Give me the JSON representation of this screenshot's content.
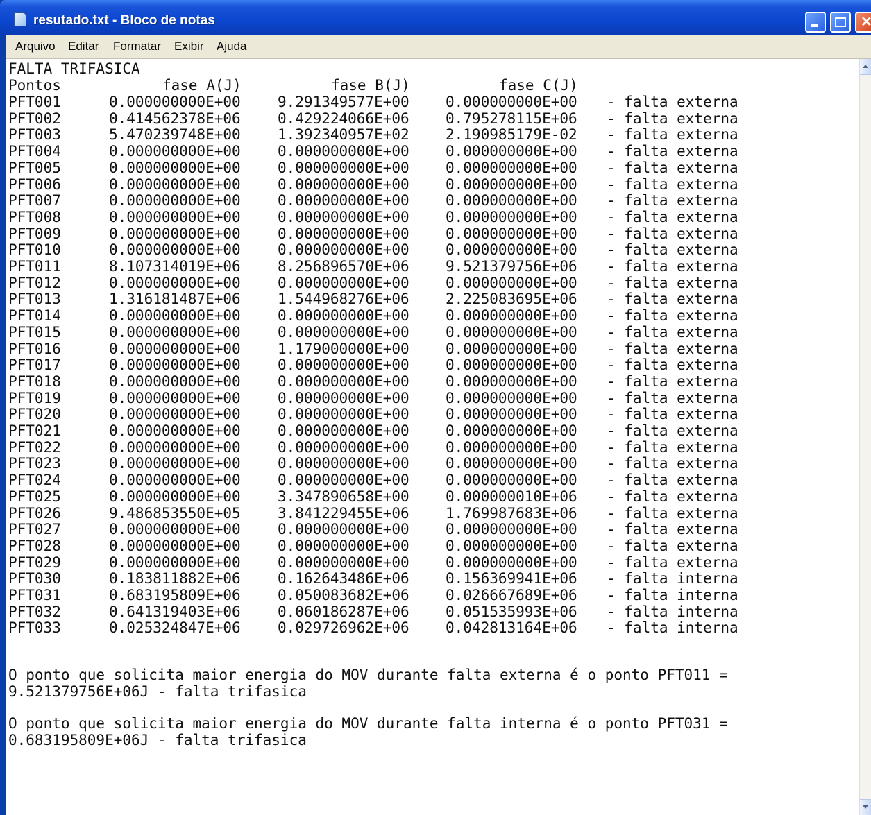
{
  "window": {
    "title": "resutado.txt - Bloco de notas"
  },
  "menu": [
    "Arquivo",
    "Editar",
    "Formatar",
    "Exibir",
    "Ajuda"
  ],
  "doc": {
    "heading": "FALTA TRIFASICA",
    "col_points": "Pontos",
    "col_a": "fase A(J)",
    "col_b": "fase B(J)",
    "col_c": "fase C(J)",
    "rows": [
      [
        "PFT001",
        "0.000000000E+00",
        "9.291349577E+00",
        "0.000000000E+00",
        "- falta externa"
      ],
      [
        "PFT002",
        "0.414562378E+06",
        "0.429224066E+06",
        "0.795278115E+06",
        "- falta externa"
      ],
      [
        "PFT003",
        "5.470239748E+00",
        "1.392340957E+02",
        "2.190985179E-02",
        "- falta externa"
      ],
      [
        "PFT004",
        "0.000000000E+00",
        "0.000000000E+00",
        "0.000000000E+00",
        "- falta externa"
      ],
      [
        "PFT005",
        "0.000000000E+00",
        "0.000000000E+00",
        "0.000000000E+00",
        "- falta externa"
      ],
      [
        "PFT006",
        "0.000000000E+00",
        "0.000000000E+00",
        "0.000000000E+00",
        "- falta externa"
      ],
      [
        "PFT007",
        "0.000000000E+00",
        "0.000000000E+00",
        "0.000000000E+00",
        "- falta externa"
      ],
      [
        "PFT008",
        "0.000000000E+00",
        "0.000000000E+00",
        "0.000000000E+00",
        "- falta externa"
      ],
      [
        "PFT009",
        "0.000000000E+00",
        "0.000000000E+00",
        "0.000000000E+00",
        "- falta externa"
      ],
      [
        "PFT010",
        "0.000000000E+00",
        "0.000000000E+00",
        "0.000000000E+00",
        "- falta externa"
      ],
      [
        "PFT011",
        "8.107314019E+06",
        "8.256896570E+06",
        "9.521379756E+06",
        "- falta externa"
      ],
      [
        "PFT012",
        "0.000000000E+00",
        "0.000000000E+00",
        "0.000000000E+00",
        "- falta externa"
      ],
      [
        "PFT013",
        "1.316181487E+06",
        "1.544968276E+06",
        "2.225083695E+06",
        "- falta externa"
      ],
      [
        "PFT014",
        "0.000000000E+00",
        "0.000000000E+00",
        "0.000000000E+00",
        "- falta externa"
      ],
      [
        "PFT015",
        "0.000000000E+00",
        "0.000000000E+00",
        "0.000000000E+00",
        "- falta externa"
      ],
      [
        "PFT016",
        "0.000000000E+00",
        "1.179000000E+00",
        "0.000000000E+00",
        "- falta externa"
      ],
      [
        "PFT017",
        "0.000000000E+00",
        "0.000000000E+00",
        "0.000000000E+00",
        "- falta externa"
      ],
      [
        "PFT018",
        "0.000000000E+00",
        "0.000000000E+00",
        "0.000000000E+00",
        "- falta externa"
      ],
      [
        "PFT019",
        "0.000000000E+00",
        "0.000000000E+00",
        "0.000000000E+00",
        "- falta externa"
      ],
      [
        "PFT020",
        "0.000000000E+00",
        "0.000000000E+00",
        "0.000000000E+00",
        "- falta externa"
      ],
      [
        "PFT021",
        "0.000000000E+00",
        "0.000000000E+00",
        "0.000000000E+00",
        "- falta externa"
      ],
      [
        "PFT022",
        "0.000000000E+00",
        "0.000000000E+00",
        "0.000000000E+00",
        "- falta externa"
      ],
      [
        "PFT023",
        "0.000000000E+00",
        "0.000000000E+00",
        "0.000000000E+00",
        "- falta externa"
      ],
      [
        "PFT024",
        "0.000000000E+00",
        "0.000000000E+00",
        "0.000000000E+00",
        "- falta externa"
      ],
      [
        "PFT025",
        "0.000000000E+00",
        "3.347890658E+00",
        "0.000000010E+06",
        "- falta externa"
      ],
      [
        "PFT026",
        "9.486853550E+05",
        "3.841229455E+06",
        "1.769987683E+06",
        "- falta externa"
      ],
      [
        "PFT027",
        "0.000000000E+00",
        "0.000000000E+00",
        "0.000000000E+00",
        "- falta externa"
      ],
      [
        "PFT028",
        "0.000000000E+00",
        "0.000000000E+00",
        "0.000000000E+00",
        "- falta externa"
      ],
      [
        "PFT029",
        "0.000000000E+00",
        "0.000000000E+00",
        "0.000000000E+00",
        "- falta externa"
      ],
      [
        "PFT030",
        "0.183811882E+06",
        "0.162643486E+06",
        "0.156369941E+06",
        "- falta interna"
      ],
      [
        "PFT031",
        "0.683195809E+06",
        "0.050083682E+06",
        "0.026667689E+06",
        "- falta interna"
      ],
      [
        "PFT032",
        "0.641319403E+06",
        "0.060186287E+06",
        "0.051535993E+06",
        "- falta interna"
      ],
      [
        "PFT033",
        "0.025324847E+06",
        "0.029726962E+06",
        "0.042813164E+06",
        "- falta interna"
      ]
    ],
    "summary_ext_1": "O ponto que solicita maior energia do MOV durante falta externa é o ponto PFT011 =",
    "summary_ext_2": "9.521379756E+06J - falta trifasica",
    "summary_int_1": "O ponto que solicita maior energia do MOV durante falta interna é o ponto PFT031 =",
    "summary_int_2": "0.683195809E+06J - falta trifasica"
  }
}
